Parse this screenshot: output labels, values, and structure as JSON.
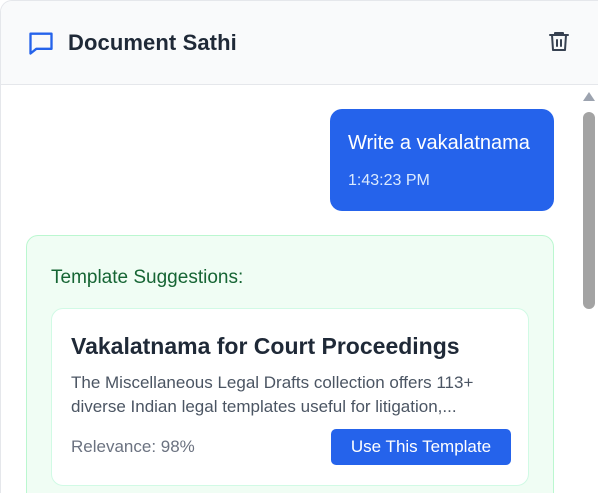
{
  "header": {
    "title": "Document Sathi",
    "chat_icon": "chat-bubble-icon",
    "delete_icon": "trash-icon"
  },
  "messages": {
    "user": {
      "text": "Write a vakalatnama",
      "time": "1:43:23 PM"
    },
    "suggestions": {
      "heading": "Template Suggestions:",
      "items": [
        {
          "title": "Vakalatnama for Court Proceedings",
          "description": "The Miscellaneous Legal Drafts collection offers 113+ diverse Indian legal templates useful for litigation,...",
          "relevance": "Relevance: 98%",
          "action_label": "Use This Template"
        }
      ]
    }
  },
  "colors": {
    "accent": "#2563eb",
    "suggestion_bg": "#f0fdf4",
    "suggestion_heading": "#166534"
  }
}
